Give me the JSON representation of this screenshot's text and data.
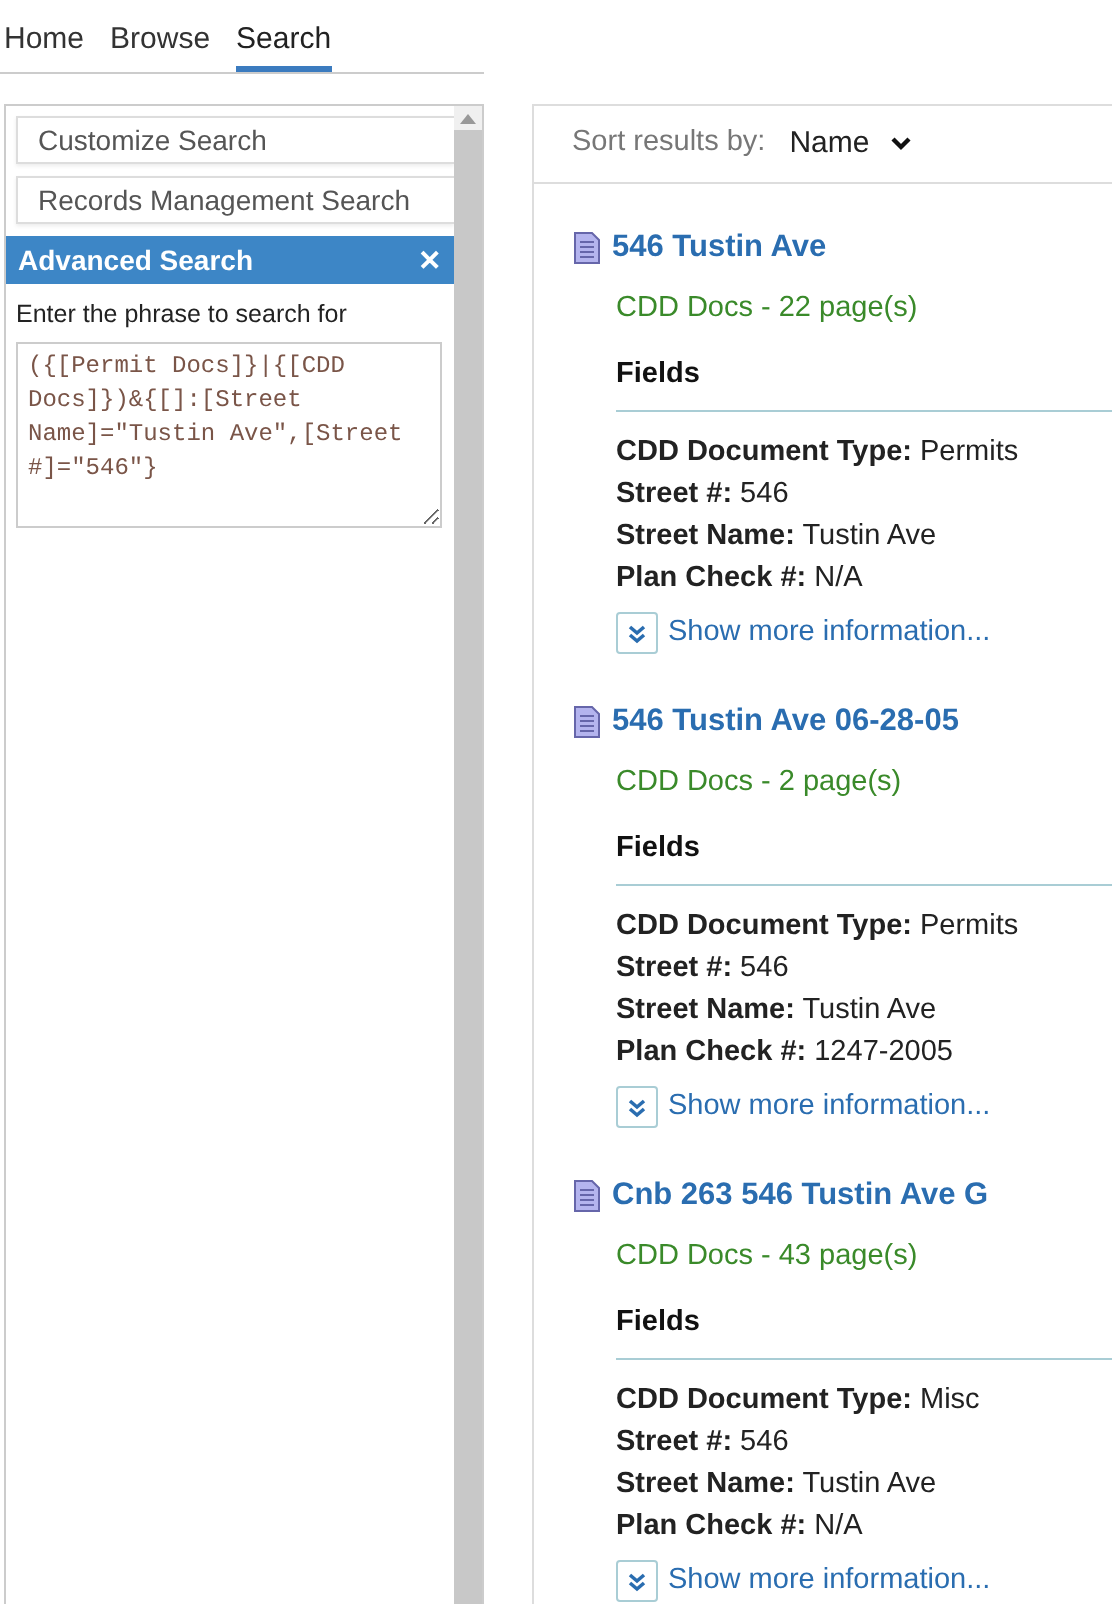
{
  "nav_tabs": [
    {
      "label": "Home",
      "selected": false
    },
    {
      "label": "Browse",
      "selected": false
    },
    {
      "label": "Search",
      "selected": true
    }
  ],
  "sidebar": {
    "dropdowns": [
      "Customize Search",
      "Records Management Search"
    ],
    "advanced_search": {
      "title": "Advanced Search",
      "close": "✕",
      "prompt": "Enter the phrase to search for",
      "query": "({[Permit Docs]}|{[CDD Docs]})&{[]:[Street Name]=\"Tustin Ave\",[Street #]=\"546\"}"
    }
  },
  "sort": {
    "label": "Sort results by:",
    "value": "Name"
  },
  "results": [
    {
      "title": "546 Tustin Ave",
      "source": "CDD Docs - 22 page(s)",
      "fields_heading": "Fields",
      "fields": [
        {
          "label": "CDD Document Type:",
          "value": "Permits"
        },
        {
          "label": "Street #:",
          "value": "546"
        },
        {
          "label": "Street Name:",
          "value": "Tustin Ave"
        },
        {
          "label": "Plan Check #:",
          "value": "N/A"
        }
      ],
      "more": "Show more information..."
    },
    {
      "title": "546 Tustin Ave 06-28-05",
      "source": "CDD Docs - 2 page(s)",
      "fields_heading": "Fields",
      "fields": [
        {
          "label": "CDD Document Type:",
          "value": "Permits"
        },
        {
          "label": "Street #:",
          "value": "546"
        },
        {
          "label": "Street Name:",
          "value": "Tustin Ave"
        },
        {
          "label": "Plan Check #:",
          "value": "1247-2005"
        }
      ],
      "more": "Show more information..."
    },
    {
      "title": "Cnb 263 546 Tustin Ave G",
      "source": "CDD Docs - 43 page(s)",
      "fields_heading": "Fields",
      "fields": [
        {
          "label": "CDD Document Type:",
          "value": "Misc"
        },
        {
          "label": "Street #:",
          "value": "546"
        },
        {
          "label": "Street Name:",
          "value": "Tustin Ave"
        },
        {
          "label": "Plan Check #:",
          "value": "N/A"
        }
      ],
      "more": "Show more information..."
    }
  ]
}
